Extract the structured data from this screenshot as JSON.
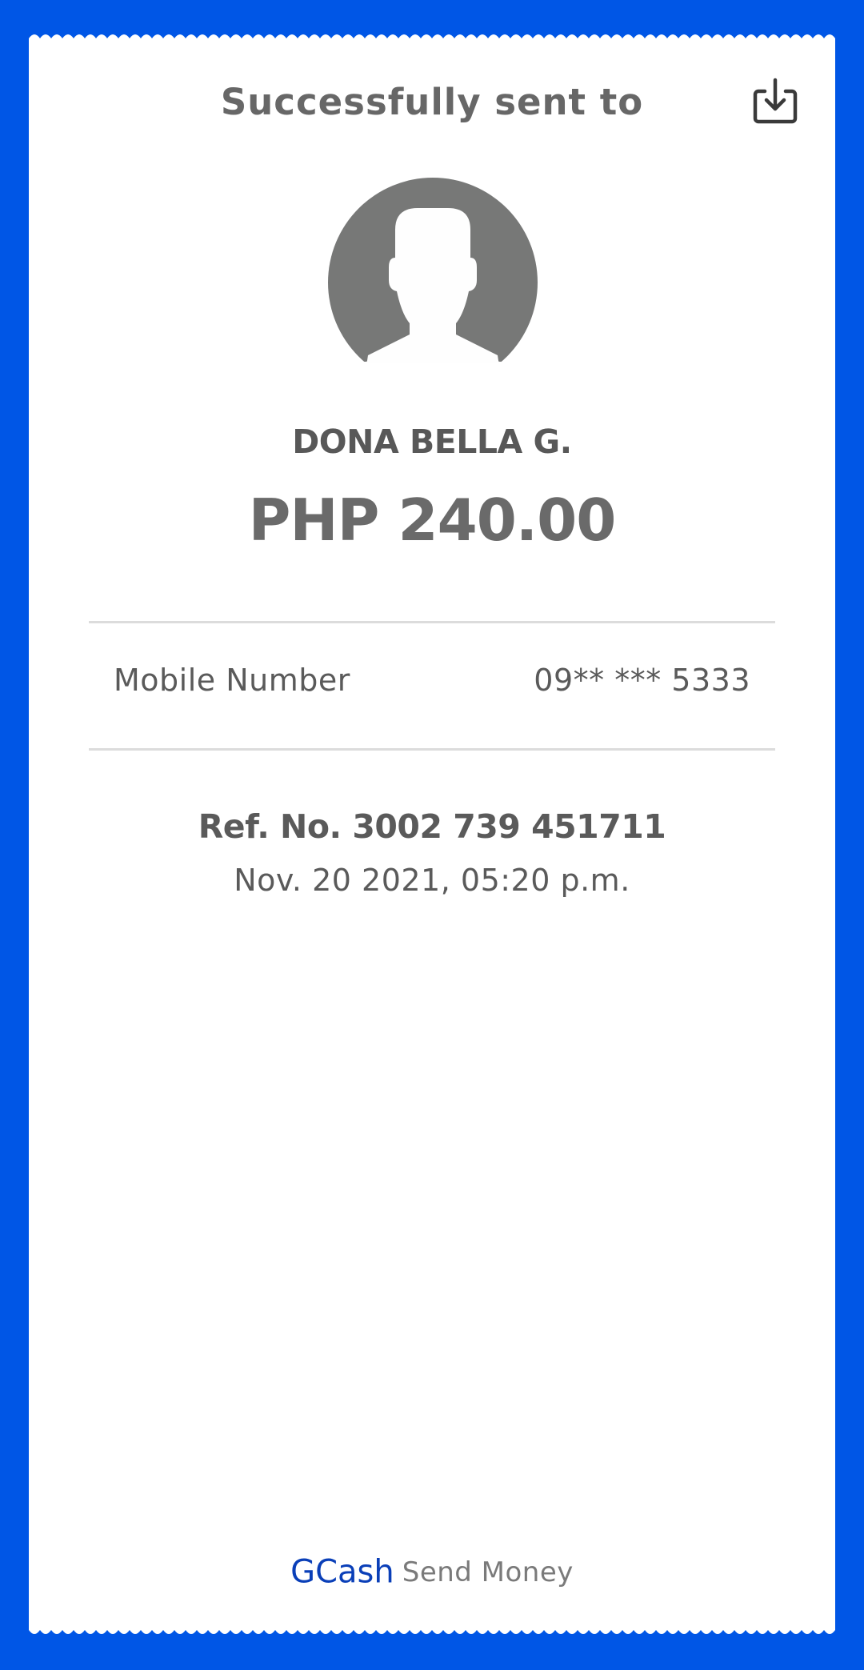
{
  "header": {
    "title": "Successfully sent to",
    "download_icon": "download-icon"
  },
  "recipient": {
    "avatar_icon": "person-silhouette-icon",
    "name": "DONA BELLA G.",
    "amount": "PHP 240.00"
  },
  "details": {
    "mobile_label": "Mobile Number",
    "mobile_value": "09** *** 5333"
  },
  "transaction": {
    "ref_no": "Ref. No. 3002 739 451711",
    "timestamp": "Nov. 20 2021, 05:20 p.m."
  },
  "footer": {
    "brand": "GCash",
    "service": "Send Money"
  },
  "colors": {
    "background": "#0056e6",
    "brand": "#0a3fb8",
    "card": "#ffffff",
    "text": "#5a5a5a",
    "avatar": "#777877"
  }
}
